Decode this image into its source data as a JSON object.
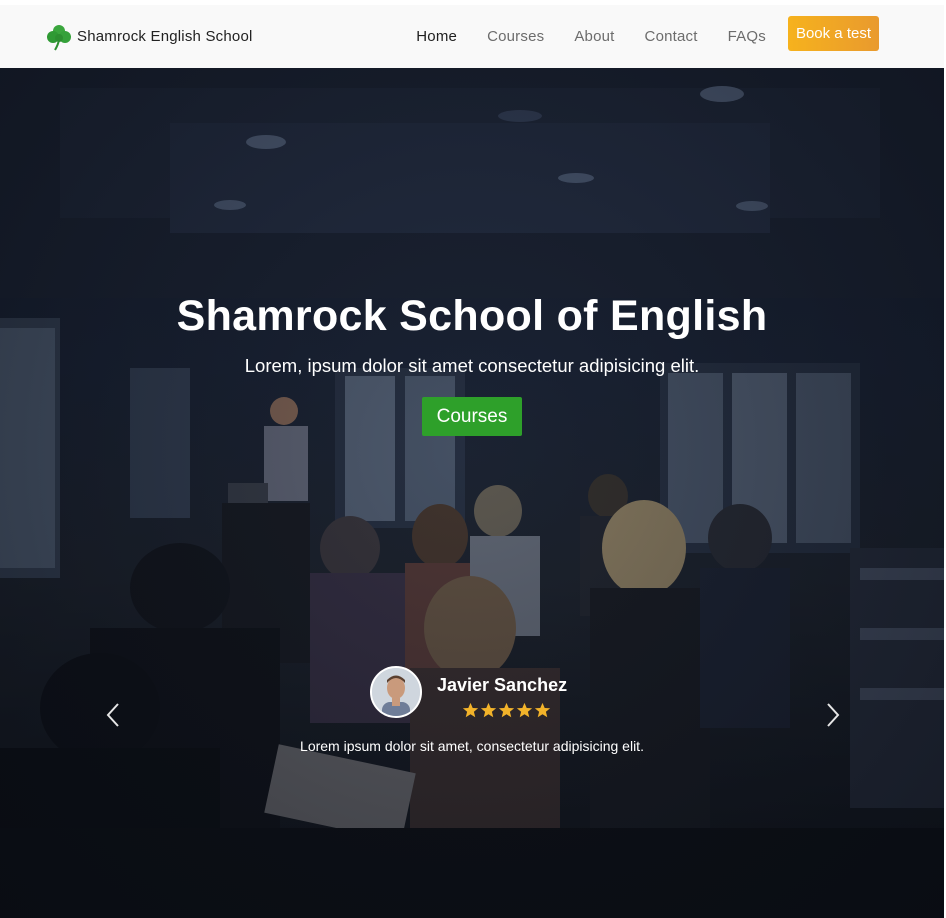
{
  "navbar": {
    "brand_name": "Shamrock English School",
    "brand_icon": "shamrock-icon",
    "links": [
      {
        "label": "Home",
        "active": true
      },
      {
        "label": "Courses",
        "active": false
      },
      {
        "label": "About",
        "active": false
      },
      {
        "label": "Contact",
        "active": false
      },
      {
        "label": "FAQs",
        "active": false
      }
    ],
    "cta_label": "Book a test"
  },
  "hero": {
    "title": "Shamrock School of English",
    "subtitle": "Lorem, ipsum dolor sit amet consectetur adipisicing elit.",
    "button_label": "Courses"
  },
  "testimonial": {
    "name": "Javier Sanchez",
    "rating": 5,
    "text": "Lorem ipsum dolor sit amet, consectetur adipisicing elit."
  },
  "colors": {
    "brand_green": "#2ea02a",
    "cta_orange": "#f0a825",
    "star_gold": "#f2b32a"
  }
}
